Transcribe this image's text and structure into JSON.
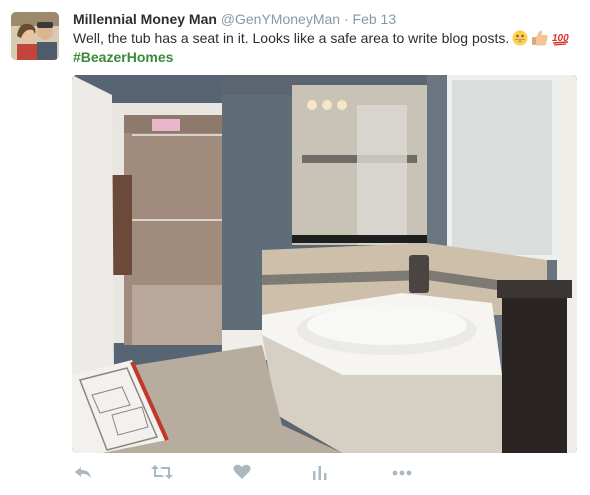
{
  "tweet": {
    "author_name": "Millennial Money Man",
    "author_handle": "@GenYMoneyMan",
    "separator": "·",
    "timestamp": "Feb 13",
    "text": "Well, the tub has a seat in it. Looks like a safe area to write blog posts.",
    "emojis": [
      "grinning-face",
      "thumbs-up-light-skin",
      "hundred-points"
    ],
    "hashtag": "#BeazerHomes"
  },
  "actions": {
    "icons": [
      "reply-icon",
      "retweet-icon",
      "like-icon",
      "analytics-icon",
      "more-icon"
    ]
  },
  "colors": {
    "text": "#292f33",
    "muted": "#8899a6",
    "hashtag": "#3b8a3b",
    "action_icon": "#aab8c2"
  }
}
